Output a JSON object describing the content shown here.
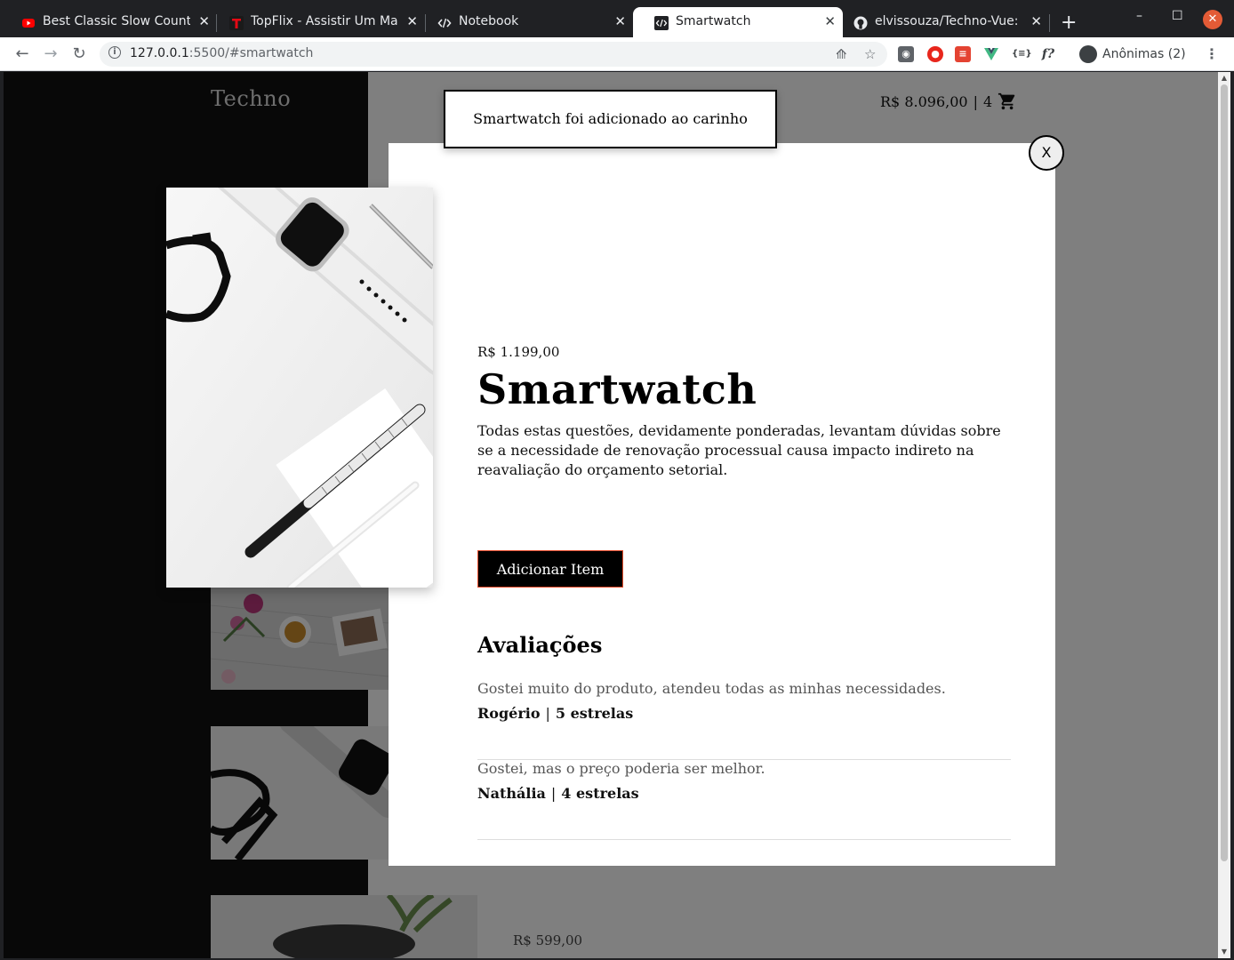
{
  "browser": {
    "tabs": [
      {
        "title": "Best Classic Slow Country",
        "icon": "youtube-icon"
      },
      {
        "title": "TopFlix - Assistir Um Mal",
        "icon": "topflix-icon"
      },
      {
        "title": "Notebook",
        "icon": "code-tab-icon"
      },
      {
        "title": "Smartwatch",
        "icon": "code-tab-icon"
      },
      {
        "title": "elvissouza/Techno-Vue: f",
        "icon": "github-icon"
      }
    ],
    "new_tab": "+",
    "url_host": "127.0.0.1",
    "url_rest": ":5500/#smartwatch",
    "profile_label": "Anônimas (2)",
    "ext_formula": "f?",
    "ext_json": "{≡}"
  },
  "site": {
    "logo": "Techno",
    "cart_total": "R$ 8.096,00",
    "cart_sep": "|",
    "cart_count": "4",
    "bg_product_price": "R$ 599,00"
  },
  "toast": {
    "message": "Smartwatch foi adicionado ao carinho"
  },
  "modal": {
    "close_label": "X",
    "price": "R$ 1.199,00",
    "title": "Smartwatch",
    "description": "Todas estas questões, devidamente ponderadas, levantam dúvidas sobre se a necessidade de renovação processual causa impacto indireto na reavaliação do orçamento setorial.",
    "add_button": "Adicionar Item",
    "reviews_title": "Avaliações",
    "reviews": [
      {
        "text": "Gostei muito do produto, atendeu todas as minhas necessidades.",
        "name": "Rogério",
        "stars": "5 estrelas"
      },
      {
        "text": "Gostei, mas o preço poderia ser melhor.",
        "name": "Nathália",
        "stars": "4 estrelas"
      }
    ]
  },
  "colors": {
    "accent_border": "#e54b2a",
    "chrome_dark": "#202124",
    "overlay": "rgba(0,0,0,0.5)"
  }
}
